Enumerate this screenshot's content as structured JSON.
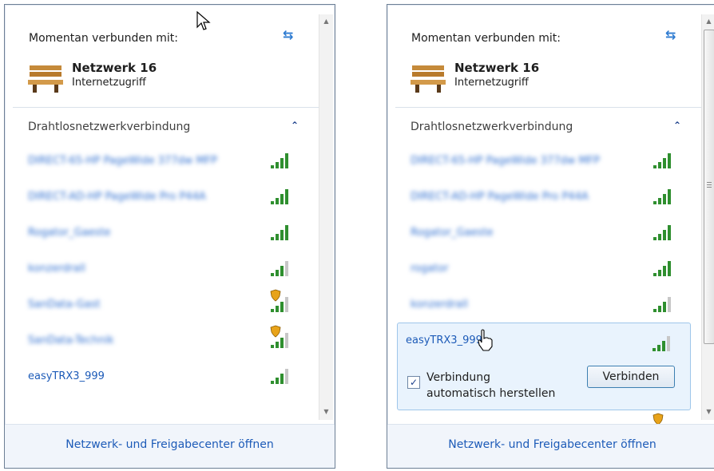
{
  "left": {
    "connected_label": "Momentan verbunden mit:",
    "network_name": "Netzwerk 16",
    "network_status": "Internetzugriff",
    "section_title": "Drahtlosnetzwerkverbindung",
    "networks": [
      {
        "label": "DIRECT-65-HP PageWide 377dw MFP",
        "secured": false,
        "bars": 4
      },
      {
        "label": "DIRECT-AD-HP PageWide Pro P44A",
        "secured": false,
        "bars": 4
      },
      {
        "label": "Rogator_Gaeste",
        "secured": false,
        "bars": 4
      },
      {
        "label": "konzerdrall",
        "secured": false,
        "bars": 3
      },
      {
        "label": "SanData-Gast",
        "secured": true,
        "bars": 3
      },
      {
        "label": "SanData-Technik",
        "secured": true,
        "bars": 3
      },
      {
        "label": "easyTRX3_999",
        "secured": false,
        "bars": 3
      }
    ],
    "footer_link": "Netzwerk- und Freigabecenter öffnen"
  },
  "right": {
    "connected_label": "Momentan verbunden mit:",
    "network_name": "Netzwerk 16",
    "network_status": "Internetzugriff",
    "section_title": "Drahtlosnetzwerkverbindung",
    "networks": [
      {
        "label": "DIRECT-65-HP PageWide 377dw MFP",
        "secured": false,
        "bars": 4
      },
      {
        "label": "DIRECT-AD-HP PageWide Pro P44A",
        "secured": false,
        "bars": 4
      },
      {
        "label": "Rogator_Gaeste",
        "secured": false,
        "bars": 4
      },
      {
        "label": "rogator",
        "secured": false,
        "bars": 4
      },
      {
        "label": "konzerdrall",
        "secured": false,
        "bars": 3
      }
    ],
    "expanded": {
      "label": "easyTRX3_999",
      "checkbox_label_line1": "Verbindung",
      "checkbox_label_line2": "automatisch herstellen",
      "checkbox_checked": true,
      "checkbox_mark": "✓",
      "connect_button": "Verbinden"
    },
    "footer_link": "Netzwerk- und Freigabecenter öffnen"
  },
  "colors": {
    "link": "#1d5bb8",
    "signal": "#2f8f2f",
    "accent": "#2e7bd1"
  },
  "icons": {
    "refresh": "refresh-icon",
    "collapse": "chevron-up-icon",
    "bench": "network-bench-icon",
    "signal": "signal-strength-icon",
    "shield": "security-shield-icon"
  },
  "glyphs": {
    "refresh": "⇆",
    "collapse": "⌃",
    "scroll_up": "▲",
    "scroll_down": "▼"
  }
}
